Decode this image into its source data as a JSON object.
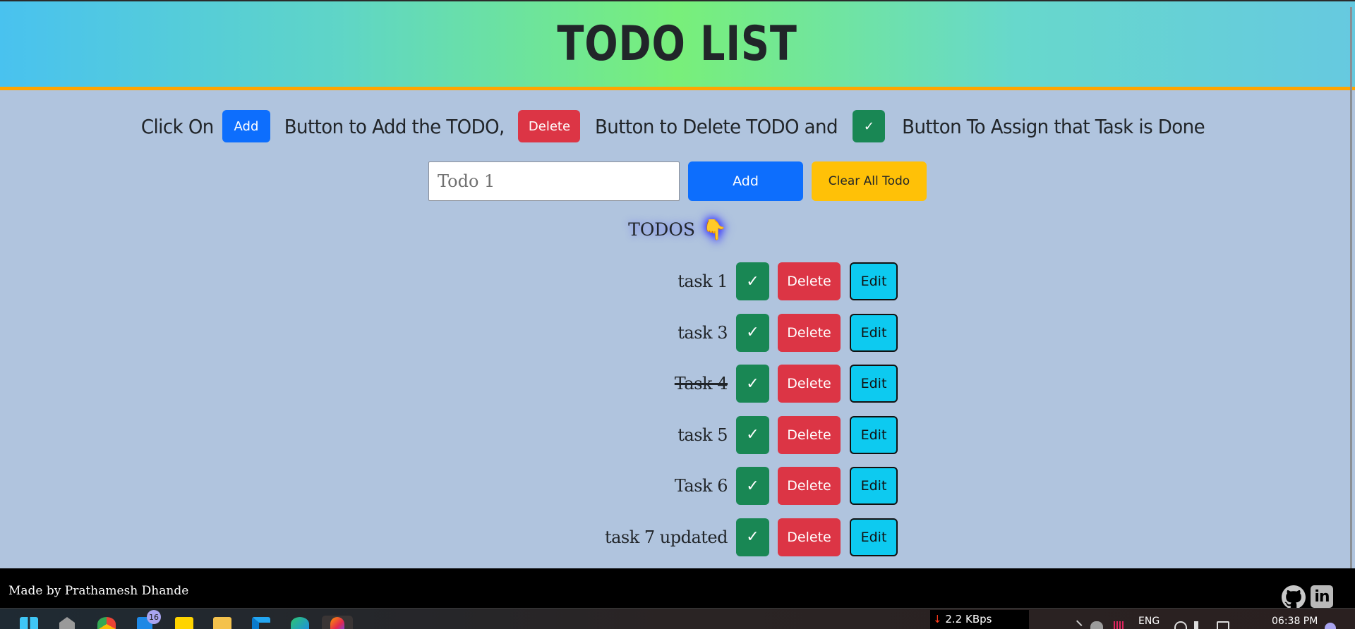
{
  "header": {
    "title": "TODO LIST"
  },
  "instructions": {
    "part1": "Click On",
    "add_label": "Add",
    "part2": "Button to Add the TODO,",
    "delete_label": "Delete",
    "part3": "Button to Delete TODO and",
    "done_label": "✓",
    "part4": "Button To Assign that Task is Done"
  },
  "form": {
    "input_placeholder": "Todo 1",
    "input_value": "",
    "add_label": "Add",
    "clear_label": "Clear All Todo"
  },
  "todos_section": {
    "heading": "TODOS",
    "icon": "👇"
  },
  "todos": [
    {
      "text": "task 1",
      "done": false,
      "check_label": "✓",
      "delete_label": "Delete",
      "edit_label": "Edit"
    },
    {
      "text": "task 3",
      "done": false,
      "check_label": "✓",
      "delete_label": "Delete",
      "edit_label": "Edit"
    },
    {
      "text": "Task 4",
      "done": true,
      "check_label": "✓",
      "delete_label": "Delete",
      "edit_label": "Edit"
    },
    {
      "text": "task 5",
      "done": false,
      "check_label": "✓",
      "delete_label": "Delete",
      "edit_label": "Edit"
    },
    {
      "text": "Task 6",
      "done": false,
      "check_label": "✓",
      "delete_label": "Delete",
      "edit_label": "Edit"
    },
    {
      "text": "task 7 updated",
      "done": false,
      "check_label": "✓",
      "delete_label": "Delete",
      "edit_label": "Edit"
    }
  ],
  "footer": {
    "credit": "Made by Prathamesh Dhande",
    "github_icon": "github-icon",
    "linkedin_label": "in"
  },
  "taskbar": {
    "mail_badge": "16",
    "net_arrow": "↓",
    "net_speed": "2.2 KBps",
    "language": "ENG",
    "time": "06:38 PM"
  },
  "colors": {
    "primary": "#0d6efd",
    "danger": "#dc3545",
    "success": "#198754",
    "warning": "#ffc107",
    "info": "#0dcaf0",
    "background": "#b0c4de",
    "header_accent": "#ffa500"
  }
}
